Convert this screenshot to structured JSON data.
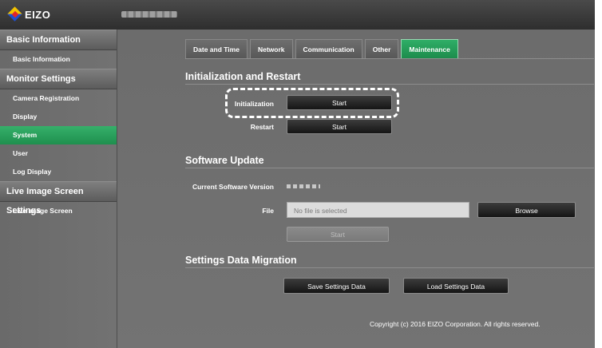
{
  "app": {
    "logo_text": "EIZO"
  },
  "sidebar": {
    "sections": [
      {
        "title": "Basic Information",
        "items": [
          "Basic Information"
        ]
      },
      {
        "title": "Monitor Settings",
        "items": [
          "Camera Registration",
          "Display",
          "System",
          "User",
          "Log Display"
        ]
      },
      {
        "title": "Live Image Screen Settings",
        "items": [
          "Live Image Screen"
        ]
      }
    ],
    "active_item": "System"
  },
  "tabs": [
    "Date and Time",
    "Network",
    "Communication",
    "Other",
    "Maintenance"
  ],
  "active_tab": "Maintenance",
  "init": {
    "title": "Initialization and Restart",
    "initialization_label": "Initialization",
    "restart_label": "Restart",
    "start_label": "Start"
  },
  "software": {
    "title": "Software Update",
    "current_version_label": "Current Software Version",
    "file_label": "File",
    "file_placeholder": "No file is selected",
    "browse_label": "Browse",
    "start_label": "Start"
  },
  "migration": {
    "title": "Settings Data Migration",
    "save_label": "Save Settings Data",
    "load_label": "Load Settings Data"
  },
  "footer": {
    "copyright": "Copyright (c) 2016 EIZO Corporation. All rights reserved."
  },
  "colors": {
    "accent": "#22965a",
    "background": "#6e6e6e",
    "highlight": "#ffffff"
  }
}
